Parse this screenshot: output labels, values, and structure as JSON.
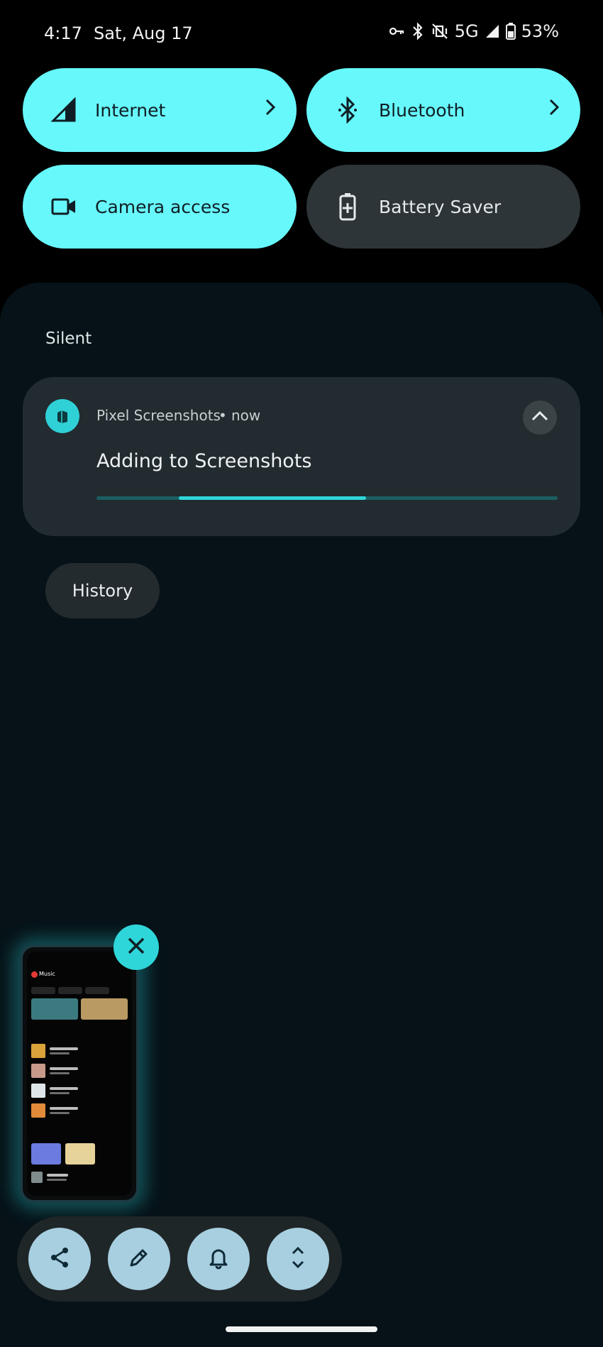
{
  "status_bar": {
    "time": "4:17",
    "date": "Sat, Aug 17",
    "network": "5G",
    "battery": "53%",
    "icons": [
      "vpn-key-icon",
      "bluetooth-icon",
      "vibrate-off-icon",
      "signal-icon",
      "battery-icon"
    ]
  },
  "quick_settings": {
    "tiles": [
      {
        "label": "Internet",
        "icon": "signal-icon",
        "state": "on",
        "has_chevron": true
      },
      {
        "label": "Bluetooth",
        "icon": "bluetooth-icon",
        "state": "on",
        "has_chevron": true
      },
      {
        "label": "Camera access",
        "icon": "videocam-icon",
        "state": "on",
        "has_chevron": false
      },
      {
        "label": "Battery Saver",
        "icon": "battery-plus-icon",
        "state": "off",
        "has_chevron": false
      }
    ]
  },
  "notifications": {
    "section_title": "Silent",
    "items": [
      {
        "app_name": "Pixel Screenshots",
        "separator": "•",
        "time": "now",
        "title": "Adding to Screenshots",
        "expanded": true,
        "progress": "indeterminate"
      }
    ],
    "history_label": "History"
  },
  "screenshot_preview": {
    "thumbnail_app": "Music",
    "actions": [
      "share-icon",
      "edit-icon",
      "bell-icon",
      "expand-icon"
    ]
  },
  "colors": {
    "tile_on": "#67f8fb",
    "tile_off": "#2d3538",
    "shade_bg": "#061217",
    "card_bg": "#222b2f",
    "accent": "#2fd6d9",
    "action_btn": "#a7cfe0"
  }
}
